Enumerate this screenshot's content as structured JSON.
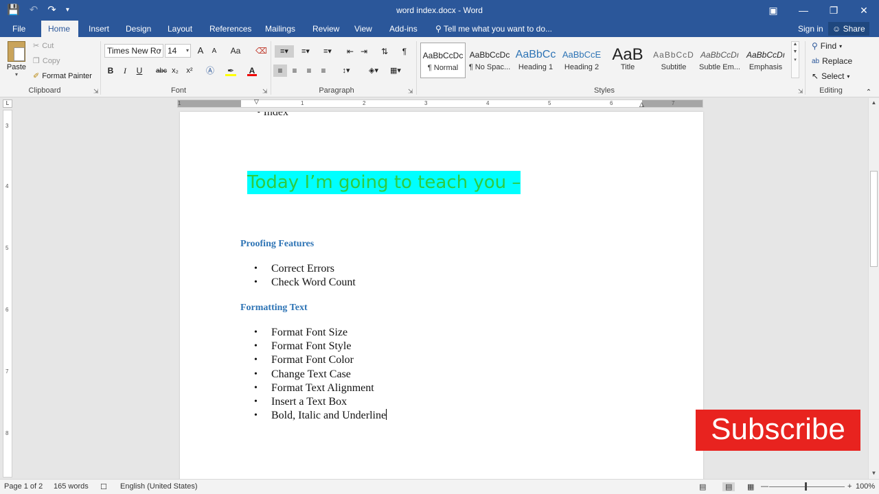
{
  "window": {
    "title": "word index.docx - Word",
    "qat_icons": [
      "save-icon",
      "undo-icon",
      "redo-icon",
      "customize-icon"
    ],
    "controls": [
      "ribbon-display-icon",
      "minimize-icon",
      "restore-icon",
      "close-icon"
    ]
  },
  "tabs": {
    "items": [
      "File",
      "Home",
      "Insert",
      "Design",
      "Layout",
      "References",
      "Mailings",
      "Review",
      "View",
      "Add-ins"
    ],
    "active": "Home",
    "tell_me": "Tell me what you want to do...",
    "sign_in": "Sign in",
    "share": "Share"
  },
  "ribbon": {
    "clipboard": {
      "paste": "Paste",
      "cut": "Cut",
      "copy": "Copy",
      "format_painter": "Format Painter",
      "label": "Clipboard"
    },
    "font": {
      "family": "Times New Ro",
      "size": "14",
      "label": "Font",
      "grow": "A",
      "shrink": "A",
      "case": "Aa",
      "bold": "B",
      "italic": "I",
      "underline": "U",
      "strike": "abc",
      "sub": "x₂",
      "sup": "x²"
    },
    "paragraph": {
      "label": "Paragraph"
    },
    "styles": {
      "label": "Styles",
      "items": [
        {
          "preview": "AaBbCcDc",
          "name": "¶ Normal"
        },
        {
          "preview": "AaBbCcDc",
          "name": "¶ No Spac..."
        },
        {
          "preview": "AaBbCc",
          "name": "Heading 1"
        },
        {
          "preview": "AaBbCcE",
          "name": "Heading 2"
        },
        {
          "preview": "AaB",
          "name": "Title"
        },
        {
          "preview": "AaBbCcD",
          "name": "Subtitle"
        },
        {
          "preview": "AaBbCcDı",
          "name": "Subtle Em..."
        },
        {
          "preview": "AaBbCcDı",
          "name": "Emphasis"
        }
      ]
    },
    "editing": {
      "label": "Editing",
      "find": "Find",
      "replace": "Replace",
      "select": "Select"
    }
  },
  "ruler": {
    "h_ticks": [
      "1",
      "1",
      "2",
      "3",
      "4",
      "5",
      "6",
      "7"
    ],
    "v_ticks": [
      "3",
      "4",
      "5",
      "6",
      "7",
      "8"
    ]
  },
  "document": {
    "top_fragment": "• Index",
    "highlight_text": "Today I’m going to teach you –",
    "sections": [
      {
        "heading": "Proofing Features",
        "items": [
          "Correct Errors",
          "Check Word Count"
        ]
      },
      {
        "heading": "Formatting Text",
        "items": [
          "Format Font Size",
          "Format Font Style",
          "Format Font Color",
          "Change Text Case",
          "Format Text Alignment",
          "Insert a Text Box",
          "Bold, Italic and Underline"
        ]
      }
    ]
  },
  "overlay": {
    "subscribe": "Subscribe"
  },
  "status": {
    "page": "Page 1 of 2",
    "words": "165 words",
    "language": "English (United States)",
    "zoom": "100%"
  },
  "colors": {
    "accent": "#2b579a",
    "highlight_bg": "#00ffff",
    "highlight_text": "#2ecc40",
    "heading": "#2e74b5",
    "subscribe_bg": "#e8231f"
  }
}
